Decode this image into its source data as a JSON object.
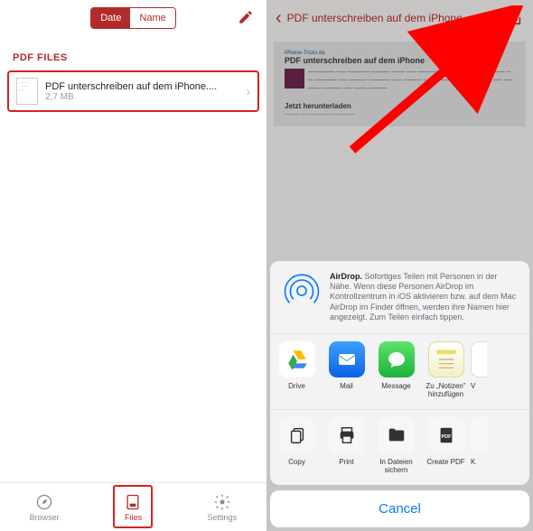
{
  "colors": {
    "accent": "#b22a2a",
    "highlight": "#d62222",
    "link": "#0a7cff"
  },
  "left": {
    "segmented": {
      "date": "Date",
      "name": "Name",
      "active": "date"
    },
    "sectionHeader": "PDF FILES",
    "file": {
      "title": "PDF unterschreiben auf dem iPhone....",
      "size": "2,7 MB"
    },
    "tabs": {
      "browser": "Browser",
      "files": "Files",
      "settings": "Settings",
      "active": "files"
    }
  },
  "right": {
    "navTitle": "PDF unterschreiben auf dem iPhone...",
    "preview": {
      "site": "iPhone-Tricks.de",
      "heading": "PDF unterschreiben auf dem iPhone",
      "subheading": "Jetzt herunterladen"
    },
    "sheet": {
      "airdropTitle": "AirDrop.",
      "airdropBody": "Sofortiges Teilen mit Personen in der Nähe. Wenn diese Personen AirDrop im Kontrollzentrum in iOS aktivieren bzw. auf dem Mac AirDrop im Finder öffnen, werden ihre Namen hier angezeigt. Zum Teilen einfach tippen.",
      "appsRow": [
        {
          "name": "Drive"
        },
        {
          "name": "Mail"
        },
        {
          "name": "Message"
        },
        {
          "name": "Zu „Notizen\" hinzufügen"
        },
        {
          "name": "V"
        }
      ],
      "actionsRow": [
        {
          "name": "Copy"
        },
        {
          "name": "Print"
        },
        {
          "name": "In Dateien sichern"
        },
        {
          "name": "Create PDF"
        },
        {
          "name": "K"
        }
      ],
      "cancel": "Cancel"
    }
  }
}
